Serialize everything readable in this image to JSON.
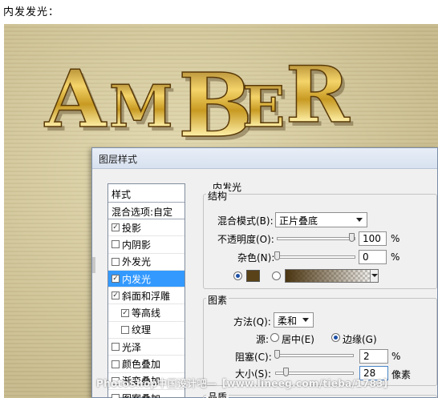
{
  "page": {
    "heading": "内发发光："
  },
  "artwork": {
    "text": "AMBER",
    "bg_color": "#d4c99c",
    "gold_color": "#c89a22"
  },
  "watermark": {
    "text": "PhotoShop中国设计吧—【www.lineeg.com/tieba/1783】"
  },
  "dialog": {
    "title": "图层样式",
    "styles_header": "样式",
    "blend_options": "混合选项:自定",
    "styles": [
      {
        "label": "投影",
        "checked": "✓"
      },
      {
        "label": "内阴影",
        "checked": ""
      },
      {
        "label": "外发光",
        "checked": ""
      },
      {
        "label": "内发光",
        "checked": "✓"
      },
      {
        "label": "斜面和浮雕",
        "checked": "✓"
      },
      {
        "label": "等高线",
        "checked": "✓"
      },
      {
        "label": "纹理",
        "checked": ""
      },
      {
        "label": "光泽",
        "checked": ""
      },
      {
        "label": "颜色叠加",
        "checked": ""
      },
      {
        "label": "渐变叠加",
        "checked": ""
      },
      {
        "label": "图案叠加",
        "checked": ""
      }
    ],
    "panel_title": "内发光",
    "structure": {
      "title": "结构",
      "blend_mode_label": "混合模式(B):",
      "blend_mode_value": "正片叠底",
      "opacity_label": "不透明度(O):",
      "opacity_value": "100",
      "opacity_unit": "%",
      "opacity_level": 1.0,
      "noise_label": "杂色(N):",
      "noise_value": "0",
      "noise_unit": "%",
      "noise_level": 0.0,
      "glow_color": "#5a4218",
      "gradient_start_color": "#4a3410"
    },
    "elements": {
      "title": "图素",
      "method_label": "方法(Q):",
      "method_value": "柔和",
      "source_label": "源:",
      "source_center": "居中(E)",
      "source_edge": "边缘(G)",
      "source_selected": "edge",
      "choke_label": "阻塞(C):",
      "choke_value": "2",
      "choke_unit": "%",
      "choke_level": 0.02,
      "size_label": "大小(S):",
      "size_value": "28",
      "size_unit": "像素",
      "size_level": 0.11
    },
    "quality": {
      "title": "品质"
    }
  }
}
